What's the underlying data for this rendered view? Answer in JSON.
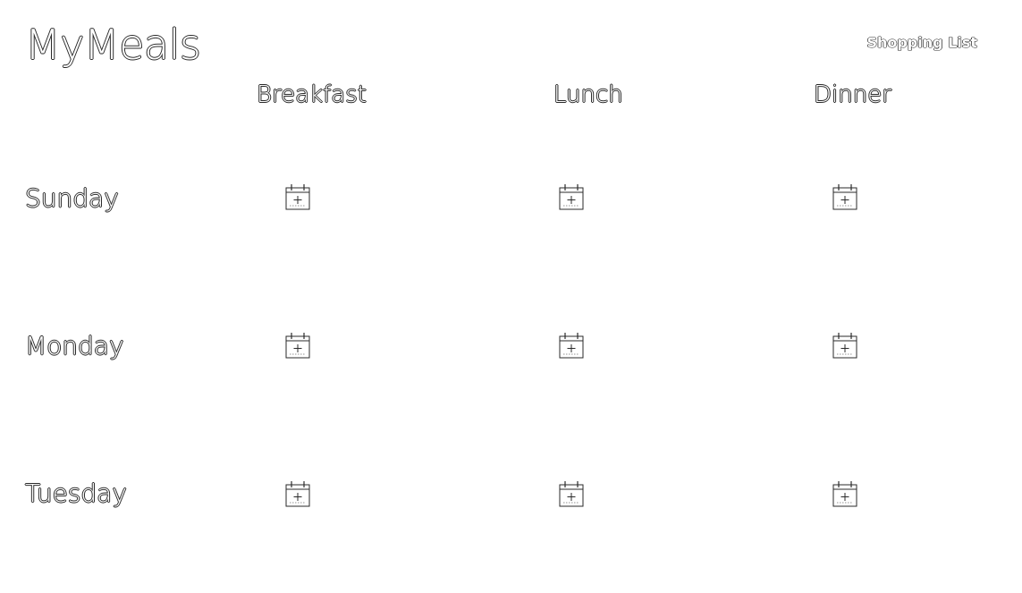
{
  "header": {
    "app_title": "MyMeals",
    "shopping_list_label": "Shopping List"
  },
  "columns": [
    {
      "label": "Breakfast"
    },
    {
      "label": "Lunch"
    },
    {
      "label": "Dinner"
    }
  ],
  "days": [
    {
      "label": "Sunday"
    },
    {
      "label": "Monday"
    },
    {
      "label": "Tuesday"
    }
  ],
  "slot_icon": "calendar-add-icon",
  "colors": {
    "background": "#ffffff",
    "outline": "#2a2a2a"
  }
}
